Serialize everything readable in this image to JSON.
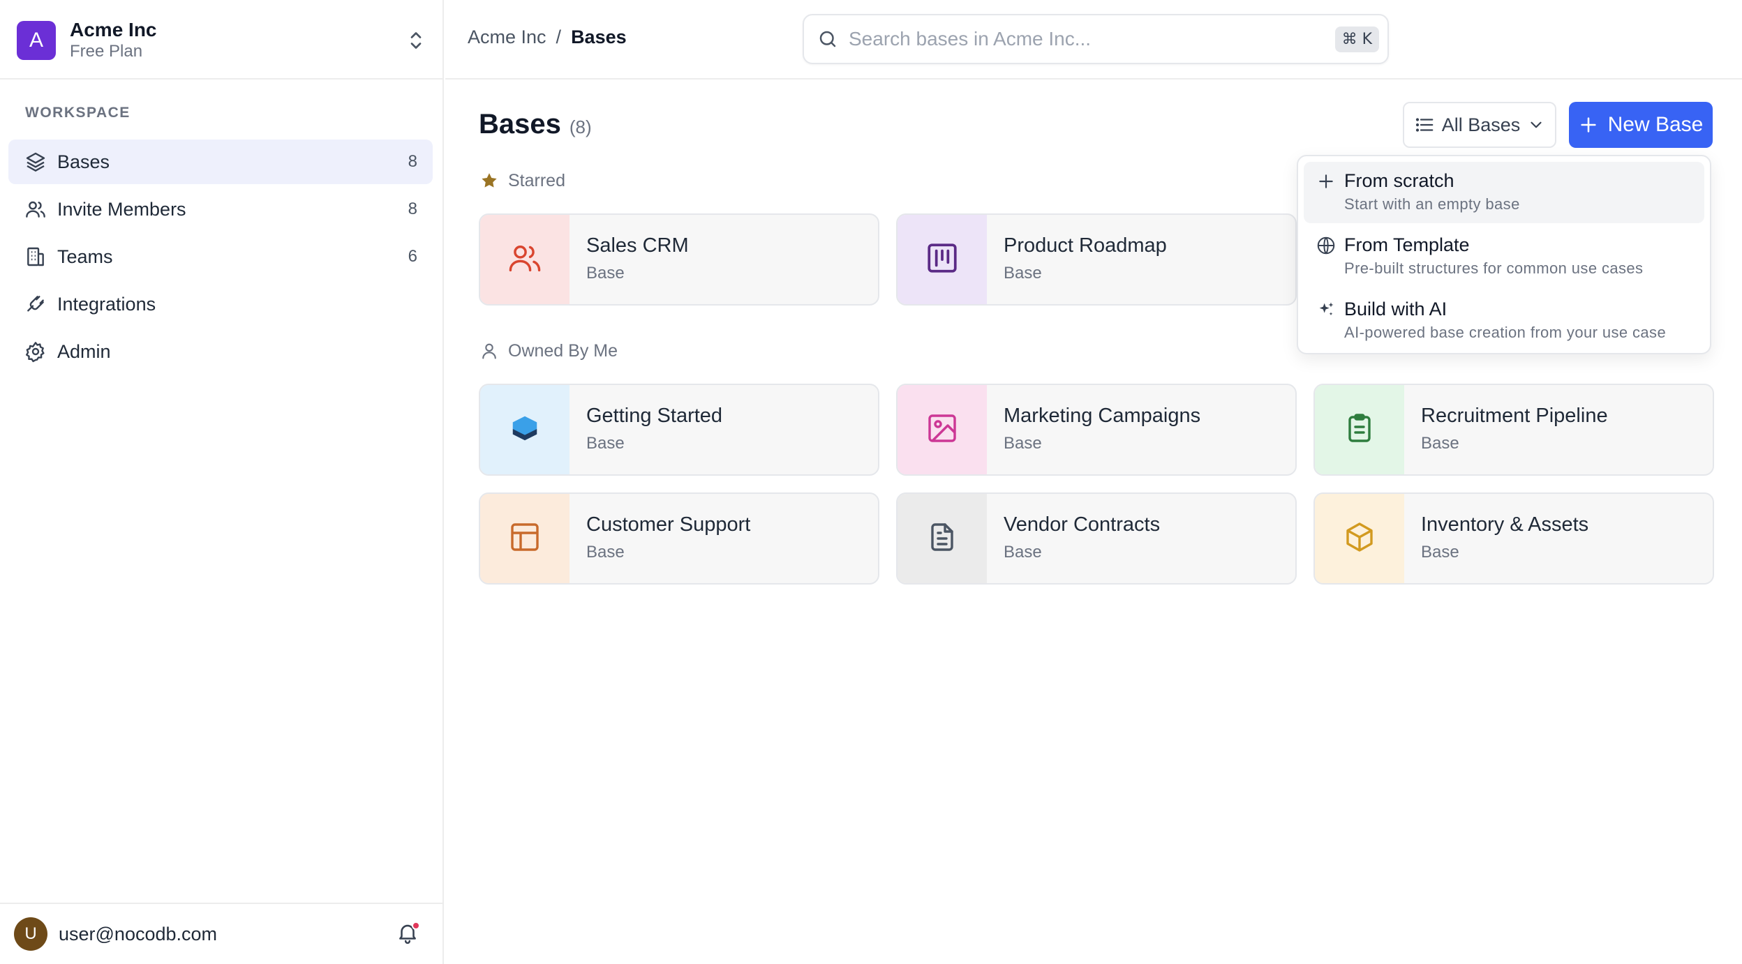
{
  "org": {
    "initial": "A",
    "name": "Acme Inc",
    "plan": "Free Plan"
  },
  "sidebar": {
    "section_label": "WORKSPACE",
    "items": [
      {
        "label": "Bases",
        "count": "8",
        "icon": "layers-icon"
      },
      {
        "label": "Invite Members",
        "count": "8",
        "icon": "users-icon"
      },
      {
        "label": "Teams",
        "count": "6",
        "icon": "building-icon"
      },
      {
        "label": "Integrations",
        "count": "",
        "icon": "plug-icon"
      },
      {
        "label": "Admin",
        "count": "",
        "icon": "gear-icon"
      }
    ]
  },
  "user": {
    "initial": "U",
    "email": "user@nocodb.com",
    "has_notification": true
  },
  "header": {
    "breadcrumb": {
      "org": "Acme Inc",
      "separator": "/",
      "current": "Bases"
    },
    "search": {
      "placeholder": "Search bases in Acme Inc...",
      "value": "",
      "shortcut": "⌘ K"
    }
  },
  "main": {
    "title": "Bases",
    "count": "(8)",
    "filter_label": "All Bases",
    "new_button_label": "New Base",
    "starred_label": "Starred",
    "owned_label": "Owned By Me",
    "starred": [
      {
        "name": "Sales CRM",
        "type": "Base",
        "icon": "users-icon",
        "bg": "#fbe3e3",
        "color": "#d9452f"
      },
      {
        "name": "Product Roadmap",
        "type": "Base",
        "icon": "kanban-icon",
        "bg": "#ede4f8",
        "color": "#5b2a86"
      }
    ],
    "owned": [
      {
        "name": "Getting Started",
        "type": "Base",
        "icon": "cube-stack-icon",
        "bg": "#e1f1fc",
        "color": "#3aa0e8"
      },
      {
        "name": "Marketing Campaigns",
        "type": "Base",
        "icon": "image-icon",
        "bg": "#fae0ef",
        "color": "#cc3795"
      },
      {
        "name": "Recruitment Pipeline",
        "type": "Base",
        "icon": "clipboard-icon",
        "bg": "#e3f6e7",
        "color": "#2e7d3e"
      },
      {
        "name": "Customer Support",
        "type": "Base",
        "icon": "layout-icon",
        "bg": "#fcebdc",
        "color": "#c86a2b"
      },
      {
        "name": "Vendor Contracts",
        "type": "Base",
        "icon": "document-icon",
        "bg": "#ebebeb",
        "color": "#4b5563"
      },
      {
        "name": "Inventory & Assets",
        "type": "Base",
        "icon": "box-icon",
        "bg": "#fdf1dc",
        "color": "#d29a1f"
      }
    ]
  },
  "dropdown": {
    "items": [
      {
        "title": "From scratch",
        "desc": "Start with an empty base",
        "icon": "plus-icon"
      },
      {
        "title": "From Template",
        "desc": "Pre-built structures for common use cases",
        "icon": "globe-icon"
      },
      {
        "title": "Build with AI",
        "desc": "AI-powered base creation from your use case",
        "icon": "sparkle-icon"
      }
    ]
  },
  "colors": {
    "accent": "#3863f4",
    "org_avatar": "#6b2fd6",
    "star": "#9a7424"
  }
}
